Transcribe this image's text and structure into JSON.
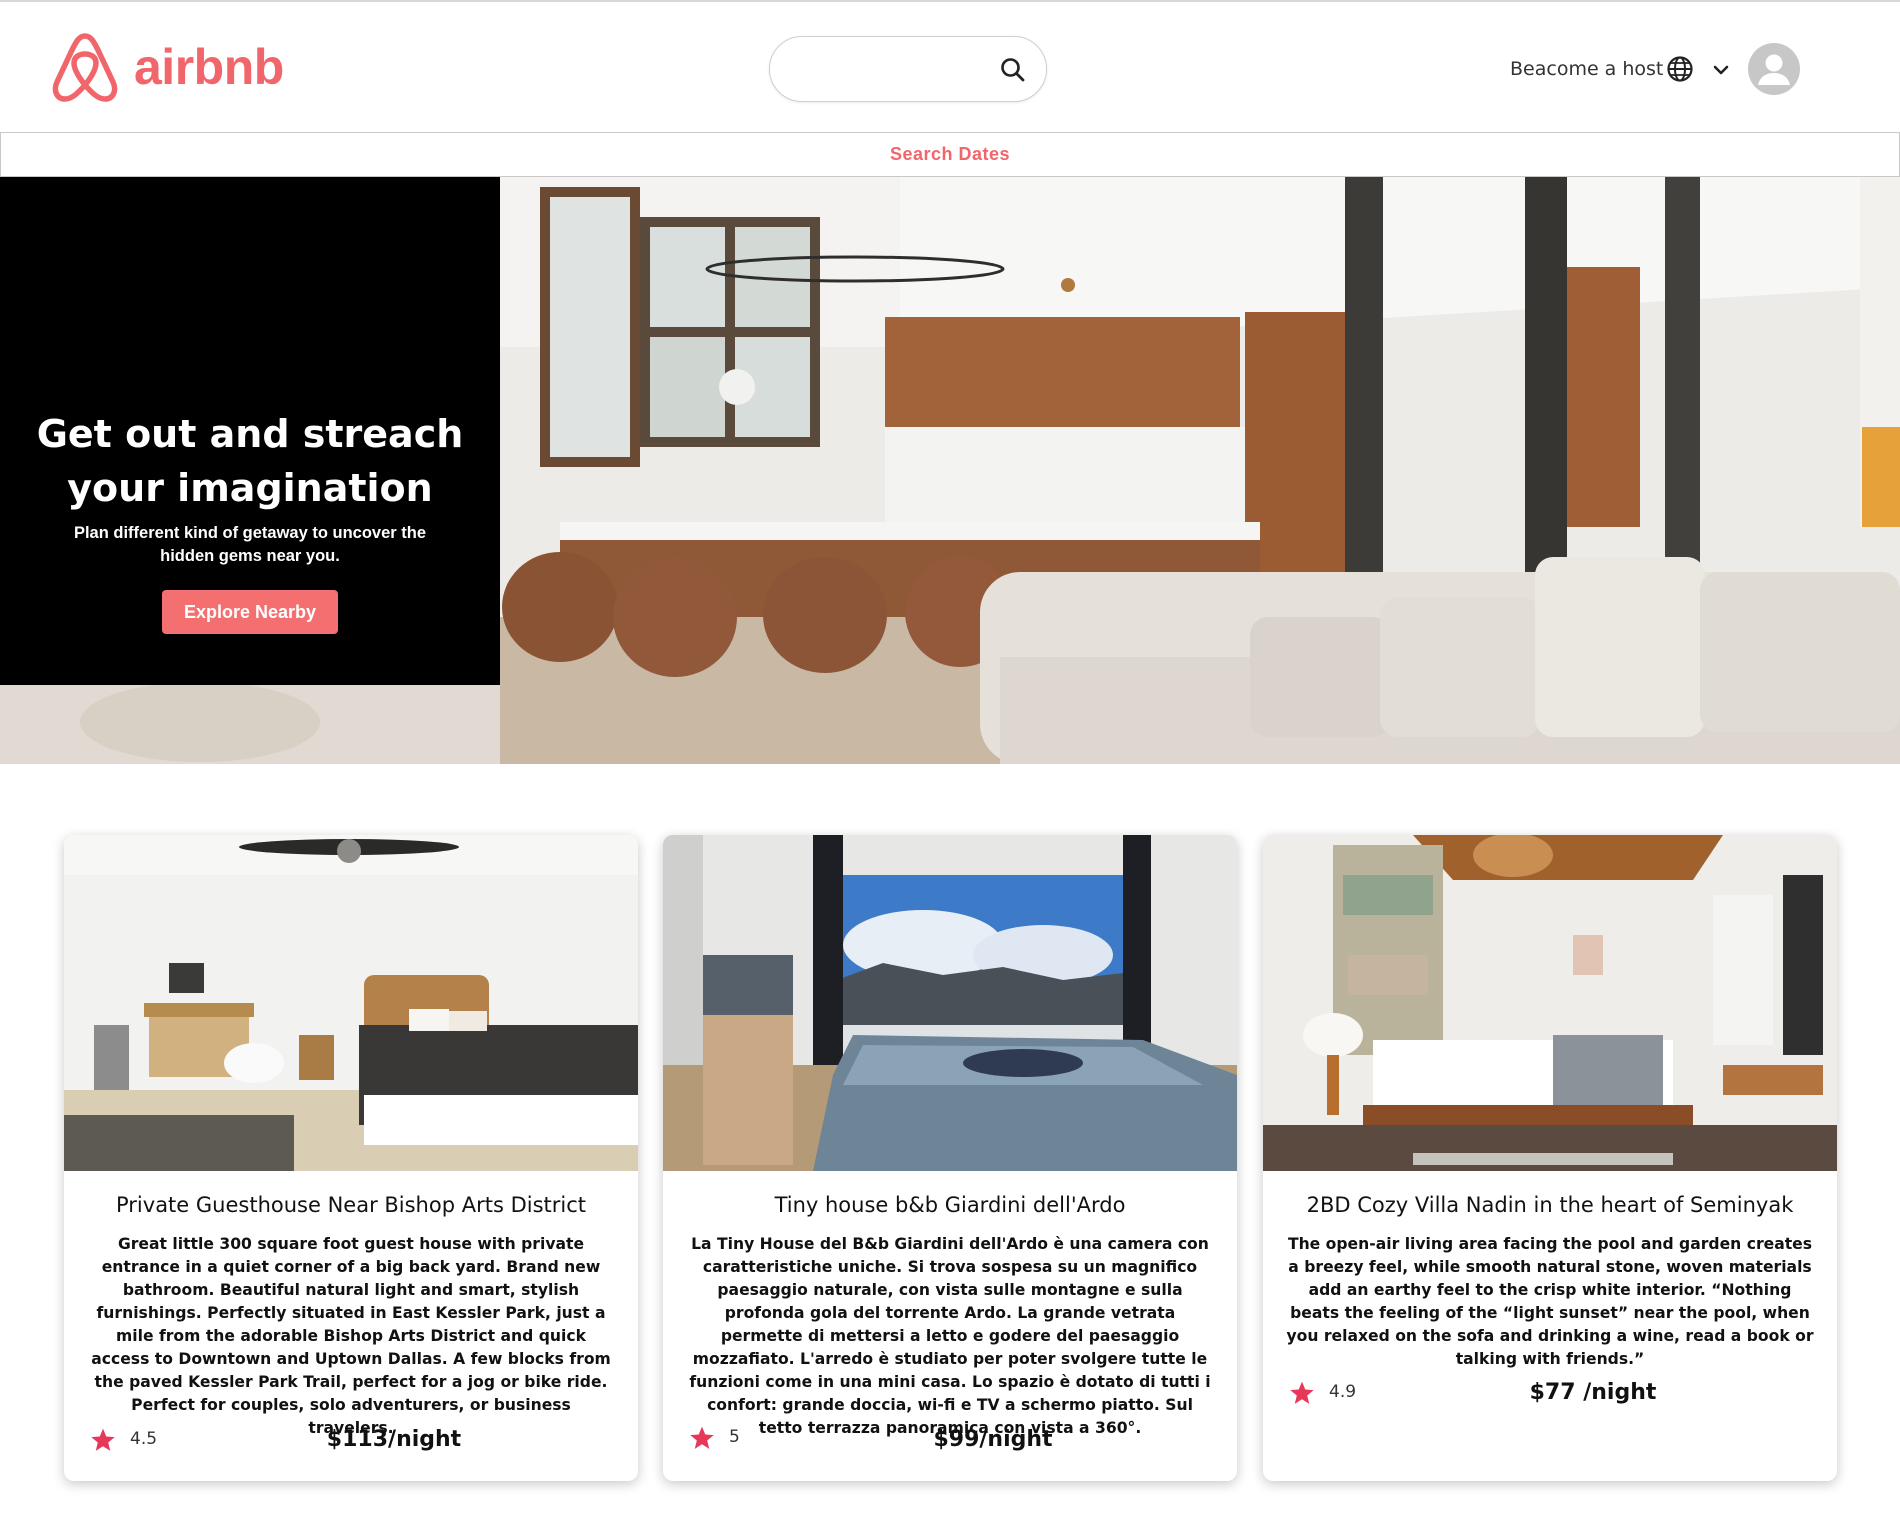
{
  "header": {
    "brand": "airbnb",
    "search": {
      "value": "",
      "placeholder": ""
    },
    "host_link": "Beacome a host",
    "search_dates": "Search Dates"
  },
  "hero": {
    "title": "Get out and streach your imagination",
    "subtitle": "Plan different kind of getaway to uncover the hidden gems near you.",
    "button": "Explore Nearby"
  },
  "listings": [
    {
      "title": "Private Guesthouse Near Bishop Arts District",
      "description": "Great little 300 square foot guest house with private entrance in a quiet corner of a big back yard. Brand new bathroom. Beautiful natural light and smart, stylish furnishings. Perfectly situated in East Kessler Park, just a mile from the adorable Bishop Arts District and quick access to Downtown and Uptown Dallas. A few blocks from the paved Kessler Park Trail, perfect for a jog or bike ride. Perfect for couples, solo adventurers, or business travelers.",
      "rating": "4.5",
      "price": "$113/night"
    },
    {
      "title": "Tiny house b&b Giardini dell'Ardo",
      "description": "La Tiny House del B&b Giardini dell'Ardo è una camera con caratteristiche uniche. Si trova sospesa su un magnifico paesaggio naturale, con vista sulle montagne e sulla profonda gola del torrente Ardo. La grande vetrata permette di mettersi a letto e godere del paesaggio mozzafiato. L'arredo è studiato per poter svolgere tutte le funzioni come in una mini casa. Lo spazio è dotato di tutti i confort: grande doccia, wi-fi e TV a schermo piatto. Sul tetto terrazza panoramica con vista a 360°.",
      "rating": "5",
      "price": "$99/night"
    },
    {
      "title": "2BD Cozy Villa Nadin in the heart of Seminyak",
      "description": "The open-air living area facing the pool and garden creates a breezy feel, while smooth natural stone, woven materials add an earthy feel to the crisp white interior. “Nothing beats the feeling of the “light sunset” near the pool, when you relaxed on the sofa and drinking a wine, read a book or talking with friends.”",
      "rating": "4.9",
      "price": "$77 /night"
    }
  ],
  "colors": {
    "brand": "#f1666a",
    "button": "#f46f6f",
    "star": "#e8385a",
    "hero_panel": "#000000"
  },
  "icons": [
    "airbnb-logo-icon",
    "search-icon",
    "globe-icon",
    "chevron-down-icon",
    "user-avatar-icon",
    "star-icon"
  ]
}
